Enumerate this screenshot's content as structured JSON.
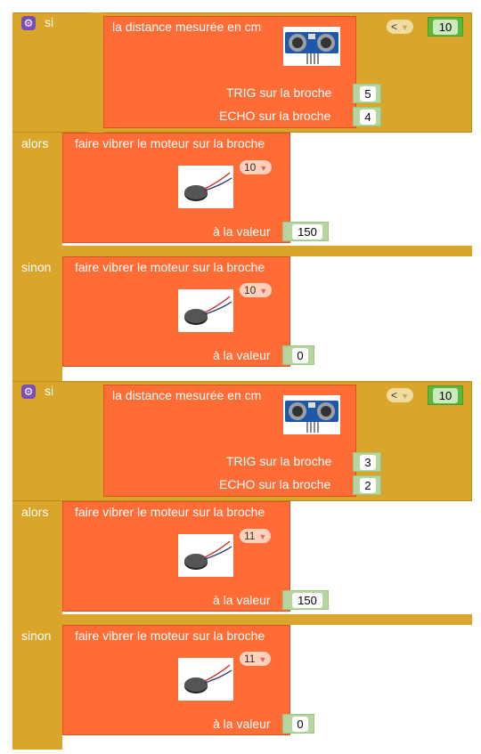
{
  "blocks": [
    {
      "if_label": "si",
      "sensor_label": "la distance mesurée en cm",
      "trig_label": "TRIG sur la broche",
      "trig_pin": "5",
      "echo_label": "ECHO sur la broche",
      "echo_pin": "4",
      "operator": "<",
      "threshold": "10",
      "then_label": "alors",
      "then_action": "faire vibrer le moteur sur la broche",
      "then_pin": "10",
      "then_value_label": "à la valeur",
      "then_value": "150",
      "else_label": "sinon",
      "else_action": "faire vibrer le moteur sur la broche",
      "else_pin": "10",
      "else_value_label": "à la valeur",
      "else_value": "0"
    },
    {
      "if_label": "si",
      "sensor_label": "la distance mesurée en cm",
      "trig_label": "TRIG sur la broche",
      "trig_pin": "3",
      "echo_label": "ECHO sur la broche",
      "echo_pin": "2",
      "operator": "<",
      "threshold": "10",
      "then_label": "alors",
      "then_action": "faire vibrer le moteur sur la broche",
      "then_pin": "11",
      "then_value_label": "à la valeur",
      "then_value": "150",
      "else_label": "sinon",
      "else_action": "faire vibrer le moteur sur la broche",
      "else_pin": "11",
      "else_value_label": "à la valeur",
      "else_value": "0"
    }
  ]
}
